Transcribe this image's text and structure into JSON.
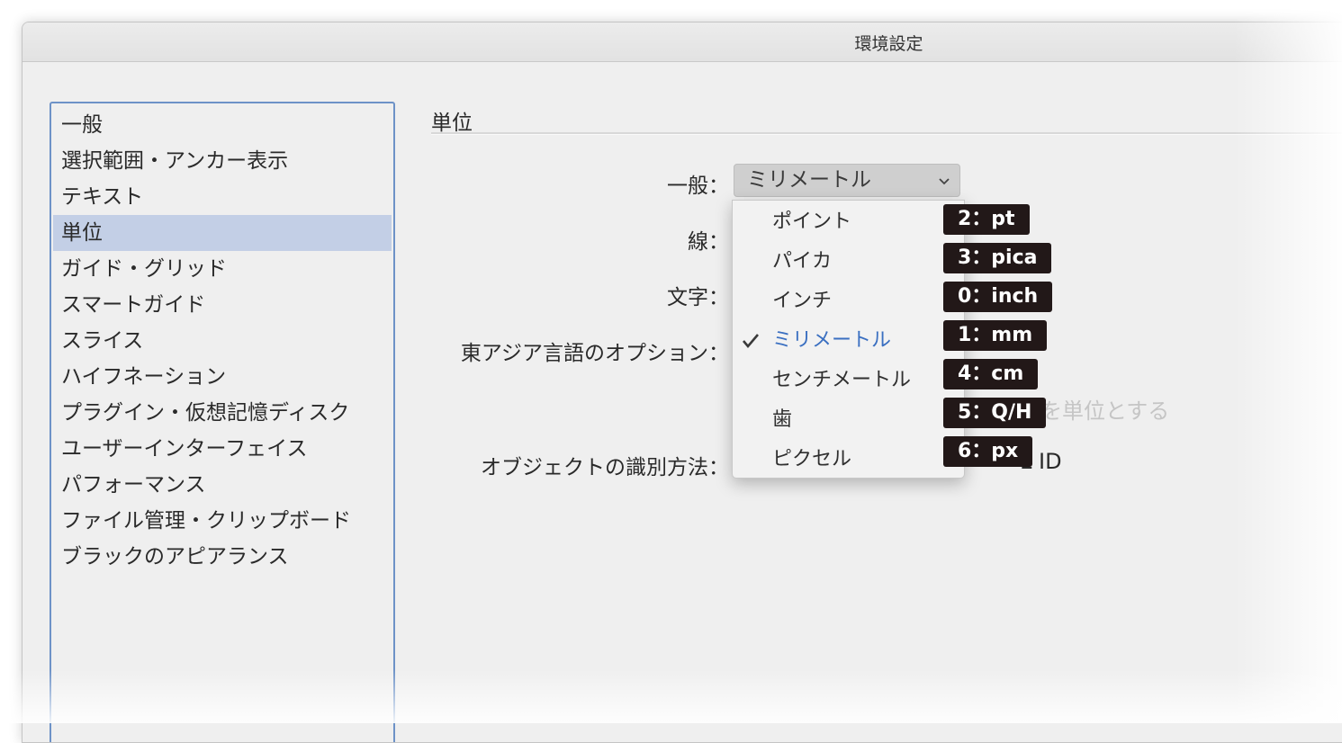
{
  "window": {
    "title": "環境設定"
  },
  "sidebar": {
    "items": [
      {
        "label": "一般"
      },
      {
        "label": "選択範囲・アンカー表示"
      },
      {
        "label": "テキスト"
      },
      {
        "label": "単位",
        "selected": true
      },
      {
        "label": "ガイド・グリッド"
      },
      {
        "label": "スマートガイド"
      },
      {
        "label": "スライス"
      },
      {
        "label": "ハイフネーション"
      },
      {
        "label": "プラグイン・仮想記憶ディスク"
      },
      {
        "label": "ユーザーインターフェイス"
      },
      {
        "label": "パフォーマンス"
      },
      {
        "label": "ファイル管理・クリップボード"
      },
      {
        "label": "ブラックのアピアランス"
      }
    ]
  },
  "main": {
    "section_title": "単位",
    "general_label": "一般：",
    "general_value": "ミリメートル",
    "stroke_label": "線：",
    "type_label": "文字：",
    "east_asian_label": "東アジア言語のオプション：",
    "east_asian_checkbox_text": "を単位とする",
    "object_id_label": "オブジェクトの識別方法：",
    "object_id_tail": "L ID"
  },
  "dropdown": {
    "options": [
      {
        "label": "ポイント",
        "badge": "2：pt"
      },
      {
        "label": "パイカ",
        "badge": "3：pica"
      },
      {
        "label": "インチ",
        "badge": "0：inch"
      },
      {
        "label": "ミリメートル",
        "badge": "1：mm",
        "checked": true
      },
      {
        "label": "センチメートル",
        "badge": "4：cm"
      },
      {
        "label": "歯",
        "badge": "5：Q/H"
      },
      {
        "label": "ピクセル",
        "badge": "6：px"
      }
    ]
  },
  "colors": {
    "selection": "#c3cfe6",
    "sidebar_border": "#6d92c7",
    "active_option": "#3a6fc1",
    "badge_bg": "#221818"
  }
}
